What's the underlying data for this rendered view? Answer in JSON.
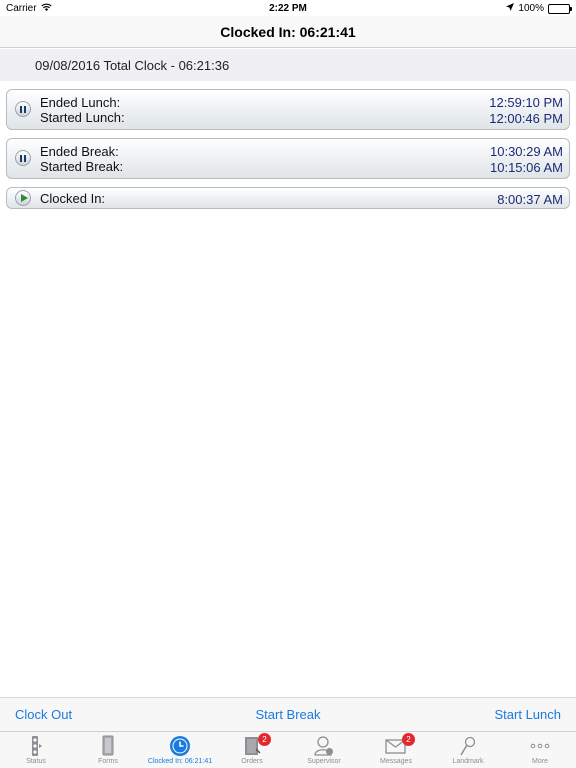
{
  "status_bar": {
    "carrier": "Carrier",
    "time": "2:22 PM",
    "battery": "100%"
  },
  "nav": {
    "title": "Clocked In: 06:21:41"
  },
  "total": {
    "text": "09/08/2016 Total Clock - 06:21:36"
  },
  "entries": [
    {
      "icon": "pause-icon",
      "labels": [
        "Ended Lunch:",
        "Started Lunch:"
      ],
      "times": [
        "12:59:10 PM",
        "12:00:46 PM"
      ]
    },
    {
      "icon": "pause-icon",
      "labels": [
        "Ended Break:",
        "Started Break:"
      ],
      "times": [
        "10:30:29 AM",
        "10:15:06 AM"
      ]
    },
    {
      "icon": "play-icon",
      "labels": [
        "Clocked In:"
      ],
      "times": [
        "8:00:37 AM"
      ]
    }
  ],
  "actions": {
    "clock_out": "Clock Out",
    "start_break": "Start Break",
    "start_lunch": "Start Lunch"
  },
  "tabs": [
    {
      "label": "Status",
      "icon": "status-icon",
      "active": false
    },
    {
      "label": "Forms",
      "icon": "forms-icon",
      "active": false
    },
    {
      "label": "Clocked In: 06:21:41",
      "icon": "clock-icon",
      "active": true
    },
    {
      "label": "Orders",
      "icon": "orders-icon",
      "active": false,
      "badge": "2"
    },
    {
      "label": "Supervisor",
      "icon": "supervisor-icon",
      "active": false
    },
    {
      "label": "Messages",
      "icon": "messages-icon",
      "active": false,
      "badge": "2"
    },
    {
      "label": "Landmark",
      "icon": "landmark-icon",
      "active": false
    },
    {
      "label": "More",
      "icon": "more-icon",
      "active": false
    }
  ],
  "colors": {
    "accent": "#1a7ae0",
    "time_text": "#1c2a7a",
    "badge": "#e3282d"
  }
}
